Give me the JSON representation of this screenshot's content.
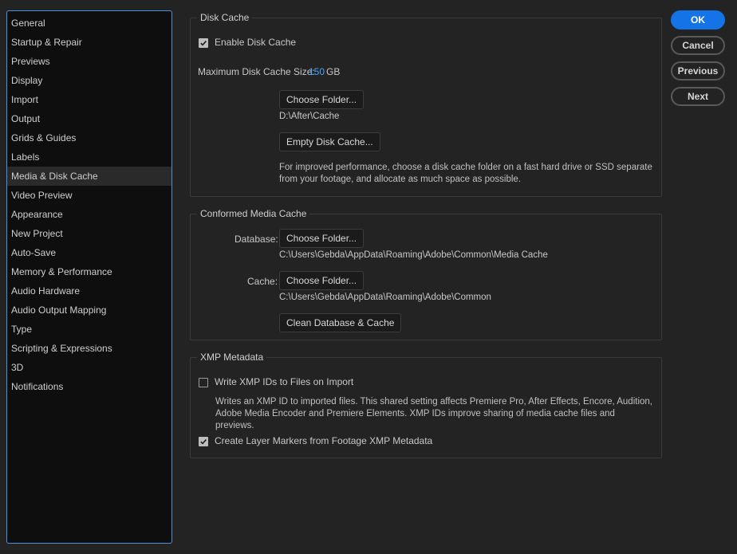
{
  "sidebar": {
    "items": [
      {
        "label": "General"
      },
      {
        "label": "Startup & Repair"
      },
      {
        "label": "Previews"
      },
      {
        "label": "Display"
      },
      {
        "label": "Import"
      },
      {
        "label": "Output"
      },
      {
        "label": "Grids & Guides"
      },
      {
        "label": "Labels"
      },
      {
        "label": "Media & Disk Cache",
        "selected": true
      },
      {
        "label": "Video Preview"
      },
      {
        "label": "Appearance"
      },
      {
        "label": "New Project"
      },
      {
        "label": "Auto-Save"
      },
      {
        "label": "Memory & Performance"
      },
      {
        "label": "Audio Hardware"
      },
      {
        "label": "Audio Output Mapping"
      },
      {
        "label": "Type"
      },
      {
        "label": "Scripting & Expressions"
      },
      {
        "label": "3D"
      },
      {
        "label": "Notifications"
      }
    ]
  },
  "disk_cache": {
    "title": "Disk Cache",
    "enable_label": "Enable Disk Cache",
    "enable_checked": true,
    "max_size_label": "Maximum Disk Cache Size:",
    "max_size_value": "150",
    "max_size_unit": "GB",
    "choose_folder_label": "Choose Folder...",
    "folder_path": "D:\\After\\Cache",
    "empty_cache_label": "Empty Disk Cache...",
    "description": "For improved performance, choose a disk cache folder on a fast hard drive or SSD separate from your footage, and allocate as much space as possible."
  },
  "conformed_cache": {
    "title": "Conformed Media Cache",
    "database_label": "Database:",
    "database_button": "Choose Folder...",
    "database_path": "C:\\Users\\Gebda\\AppData\\Roaming\\Adobe\\Common\\Media Cache",
    "cache_label": "Cache:",
    "cache_button": "Choose Folder...",
    "cache_path": "C:\\Users\\Gebda\\AppData\\Roaming\\Adobe\\Common",
    "clean_label": "Clean Database & Cache"
  },
  "xmp": {
    "title": "XMP Metadata",
    "write_ids_label": "Write XMP IDs to Files on Import",
    "write_ids_checked": false,
    "write_ids_description": "Writes an XMP ID to imported files. This shared setting affects Premiere Pro, After Effects, Encore, Audition, Adobe Media Encoder and Premiere Elements. XMP IDs improve sharing of media cache files and previews.",
    "layer_markers_label": "Create Layer Markers from Footage XMP Metadata",
    "layer_markers_checked": true
  },
  "dialog_buttons": {
    "ok": "OK",
    "cancel": "Cancel",
    "previous": "Previous",
    "next": "Next"
  }
}
